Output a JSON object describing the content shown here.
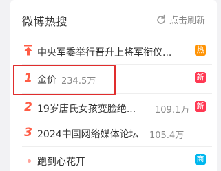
{
  "header": {
    "title": "微博热搜",
    "refresh_label": "点击刷新"
  },
  "items": [
    {
      "rank": "",
      "icon": "top-arrow-icon",
      "text": "中央军委举行晋升上将军衔仪...",
      "count": "",
      "badge": "热",
      "badge_color": "#ff9406"
    },
    {
      "rank": "1",
      "text": "金价",
      "count": "234.5万",
      "badge": "新",
      "badge_color": "#ff3852"
    },
    {
      "rank": "2",
      "text": "19岁唐氏女孩变脸绝...",
      "count": "109.1万",
      "badge": "新",
      "badge_color": "#ff3852"
    },
    {
      "rank": "3",
      "text": "2024中国网络媒体论坛",
      "count": "105.4万",
      "badge": "",
      "badge_color": ""
    },
    {
      "rank": "",
      "icon": "dot-icon",
      "text": "跑到心花开",
      "count": "",
      "badge": "商",
      "badge_color": "#00b7ee"
    }
  ],
  "colors": {
    "accent": "#ff5c45",
    "highlight_box": "#e02d2d"
  }
}
